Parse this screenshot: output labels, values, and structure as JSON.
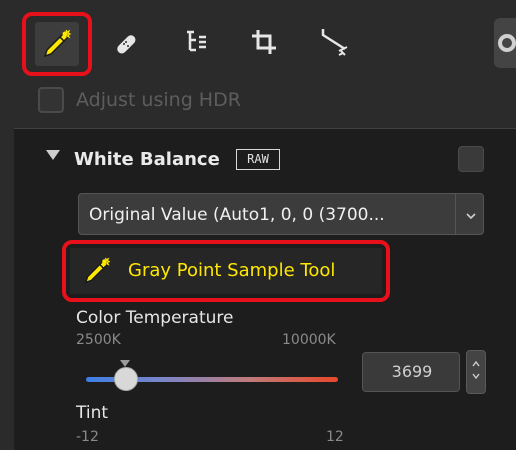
{
  "toolbar": {
    "tools": [
      {
        "icon": "eyedropper-icon",
        "active": true
      },
      {
        "icon": "bandage-icon"
      },
      {
        "icon": "tree-hierarchy-icon"
      },
      {
        "icon": "crop-icon"
      },
      {
        "icon": "straighten-icon"
      }
    ],
    "accent_color": "#e8101a",
    "tool_color": "#ffe800"
  },
  "hdr": {
    "label": "Adjust using HDR",
    "checked": false
  },
  "white_balance": {
    "title": "White Balance",
    "badge": "RAW",
    "dropdown_value": "Original Value (Auto1, 0, 0 (3700...",
    "gray_point_tool_label": "Gray Point Sample Tool"
  },
  "color_temperature": {
    "label": "Color Temperature",
    "min_label": "2500K",
    "max_label": "10000K",
    "value": "3699"
  },
  "tint": {
    "label": "Tint",
    "min_label": "-12",
    "max_label": "12"
  }
}
